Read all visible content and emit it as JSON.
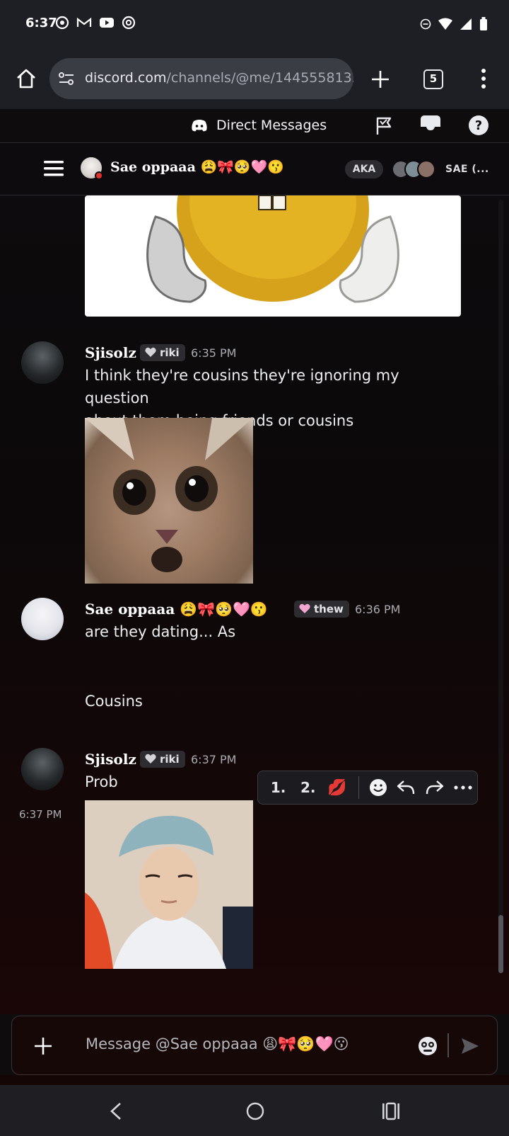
{
  "status_bar": {
    "time": "6:37",
    "left_icons": [
      "chrome-icon",
      "gmail-icon",
      "youtube-icon",
      "threads-icon"
    ],
    "right_icons": [
      "dnd-icon",
      "wifi-icon",
      "signal-icon",
      "battery-icon"
    ]
  },
  "browser": {
    "url_domain": "discord.com",
    "url_path": "/channels/@me/1445558132",
    "tab_count": "5"
  },
  "dm_header": {
    "title": "Direct Messages"
  },
  "channel": {
    "name": "Sae oppaaa 😩🎀🥺🩷😗",
    "aka_label": "AKA",
    "group_label": "SAE (..."
  },
  "messages": [
    {
      "author": "Sjisolz",
      "tag": "riki",
      "time": "6:35 PM",
      "text_line1": "I think they're cousins they're ignoring my question",
      "text_line2": "about them being friends or cousins",
      "attachment": "cat-gif"
    },
    {
      "author": "Sae oppaaa 😩🎀🥺🩷😗",
      "tag": "thew",
      "time": "6:36 PM",
      "text": "are they dating... As",
      "followup": "Cousins"
    },
    {
      "author": "Sjisolz",
      "tag": "riki",
      "time": "6:37 PM",
      "side_time": "6:37 PM",
      "text": "Prob",
      "attachment": "person-gif"
    }
  ],
  "hover_toolbar": {
    "items": [
      "1.",
      "2.",
      "💋"
    ],
    "icons": [
      "emoji-icon",
      "reply-icon",
      "forward-icon",
      "more-icon"
    ]
  },
  "composer": {
    "placeholder": "Message @Sae oppaaa 😩🎀🥺🩷😗"
  },
  "colors": {
    "background": "#0d0b0d",
    "composer_bg": "#170808",
    "tag_bg": "#2d2c31",
    "text": "#eceef1",
    "muted": "#a9abb1"
  }
}
